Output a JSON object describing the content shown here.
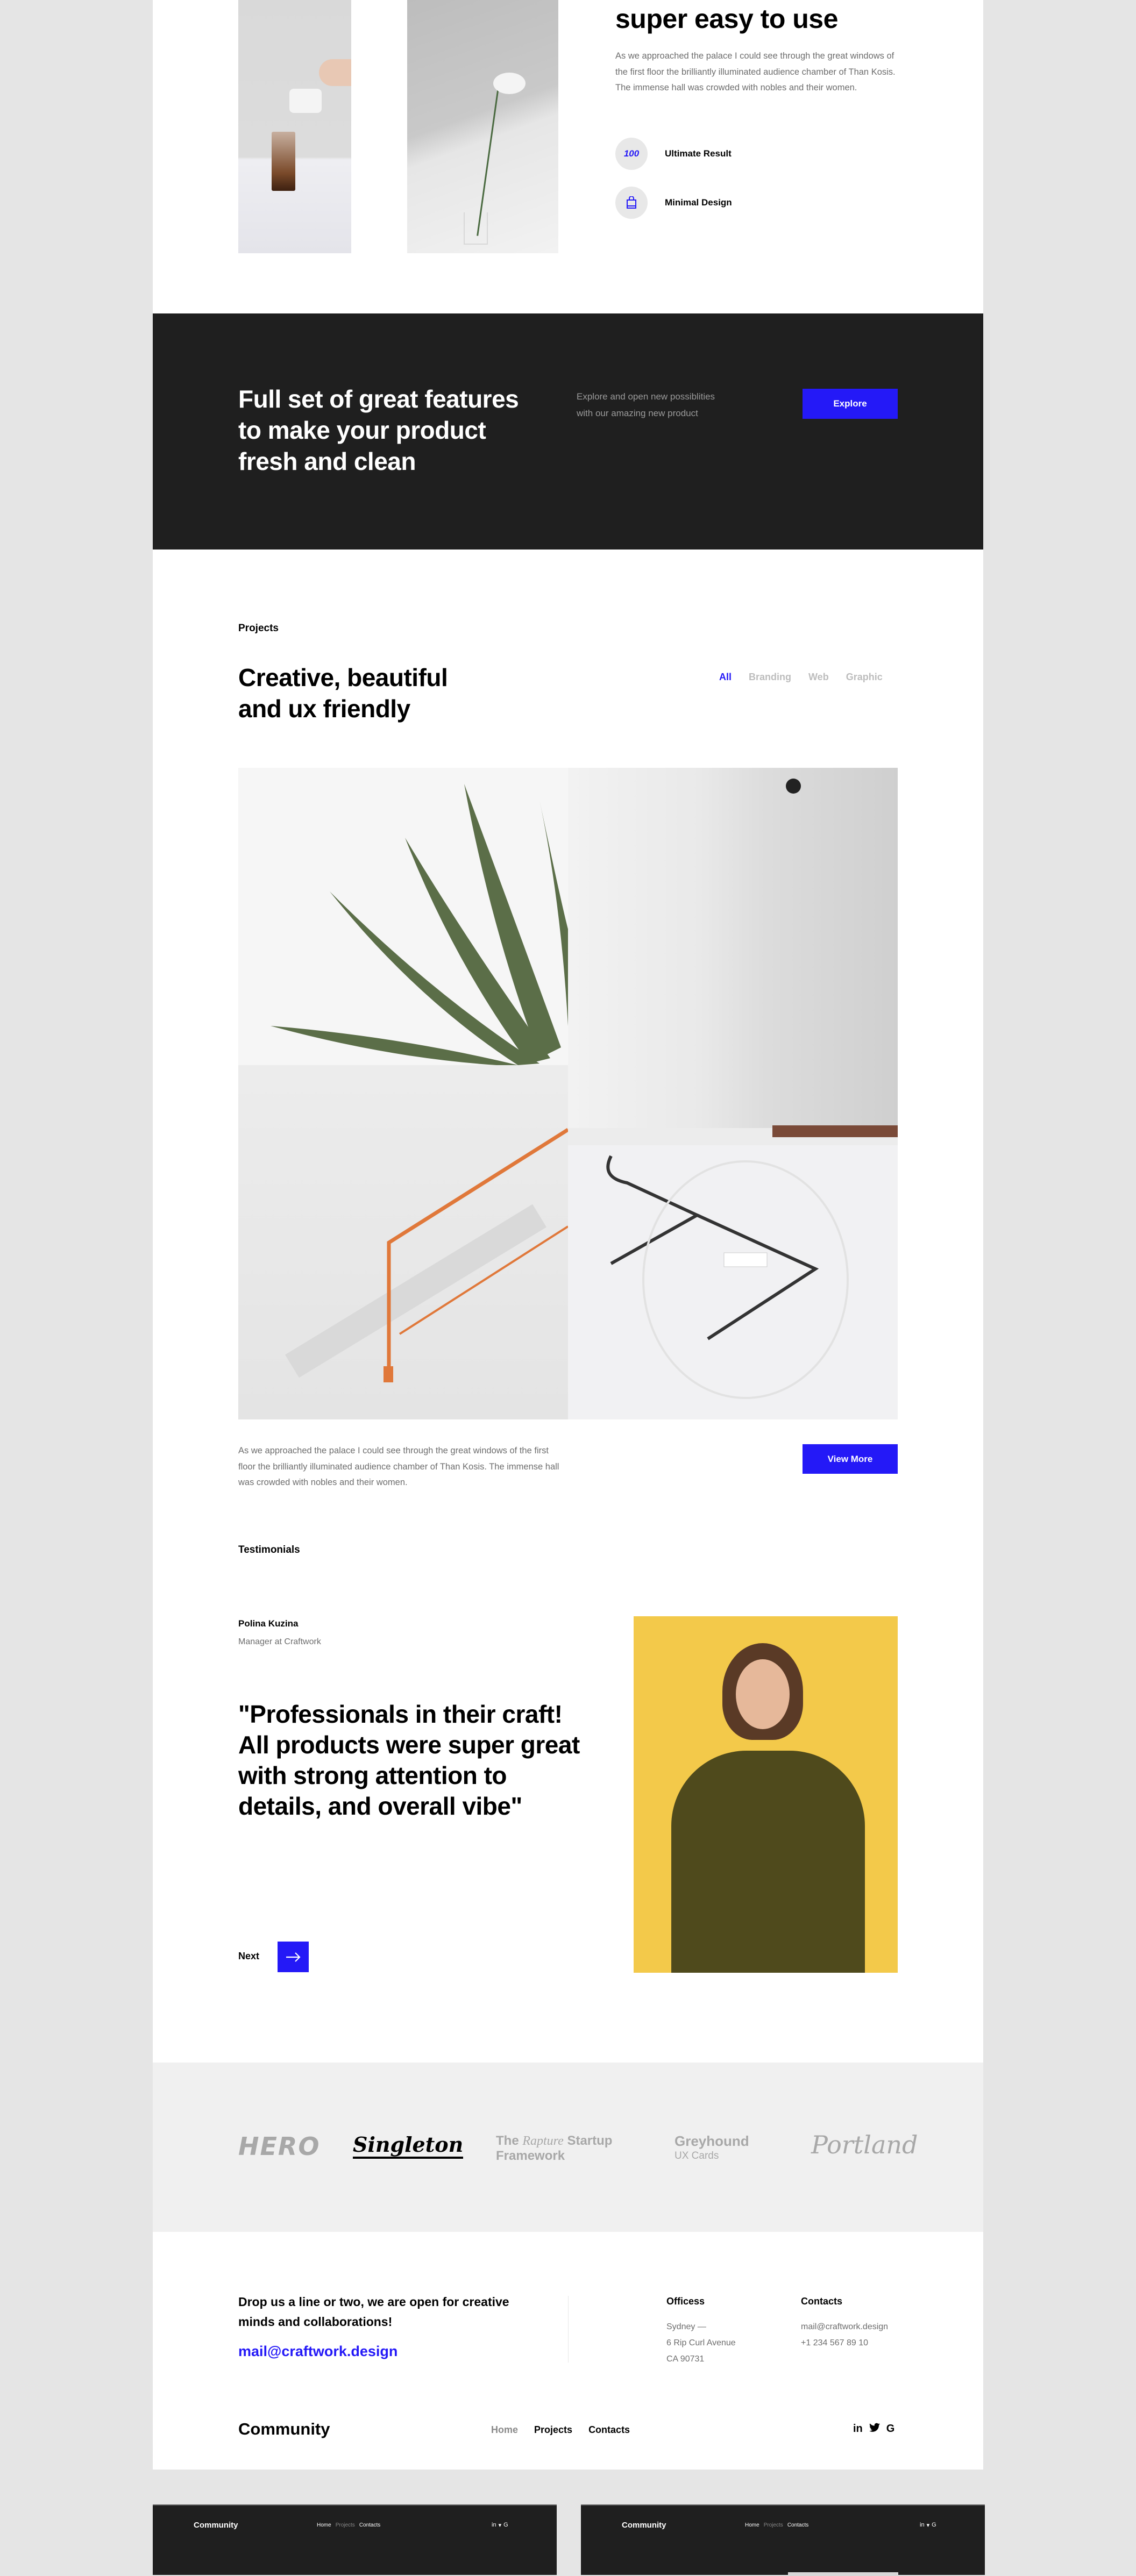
{
  "intro": {
    "heading": "super easy to use",
    "paragraph": "As we approached the palace I could see through the great windows of the first floor the brilliantly illuminated audience chamber of Than Kosis. The immense hall was crowded with nobles and their women.",
    "features": [
      {
        "icon": "hundred-points-icon",
        "glyph": "100",
        "label": "Ultimate Result"
      },
      {
        "icon": "shopping-bag-icon",
        "glyph": "",
        "label": "Minimal Design"
      }
    ]
  },
  "banner": {
    "heading_lines": [
      "Full set of great features",
      "to make your product",
      "fresh and clean"
    ],
    "subtext_lines": [
      "Explore and open new possiblities",
      "with our amazing new product"
    ],
    "button": "Explore"
  },
  "projects": {
    "label": "Projects",
    "heading_lines": [
      "Creative, beautiful",
      "and ux friendly"
    ],
    "filters": [
      "All",
      "Branding",
      "Web",
      "Graphic"
    ],
    "active_filter": "All",
    "description": "As we approached the palace I could see through the great windows of the first floor the brilliantly illuminated audience chamber of Than Kosis. The immense hall was crowded with nobles and their women.",
    "button": "View More"
  },
  "testimonials": {
    "label": "Testimonials",
    "name": "Polina Kuzina",
    "role": "Manager at Craftwork",
    "quote": "\"Professionals in their craft! All products were super great with strong attention to details, and overall vibe\"",
    "next_label": "Next",
    "next_icon": "arrow-right-icon"
  },
  "logos": {
    "hero": "HERO",
    "singleton": "Singleton",
    "rapture": {
      "the": "The",
      "rapture": "Rapture",
      "startup": "Startup",
      "framework": "Framework"
    },
    "greyhound": {
      "name": "Greyhound",
      "sub": "UX Cards"
    },
    "portland": "Portland"
  },
  "contact": {
    "heading": "Drop us a line or two, we are open for creative minds and collaborations!",
    "email": "mail@craftwork.design",
    "offices_title": "Officess",
    "offices_lines": [
      "Sydney —",
      "6 Rip Curl Avenue",
      "CA 90731"
    ],
    "contacts_title": "Contacts",
    "contacts_lines": [
      "mail@craftwork.design",
      "+1 234 567 89 10"
    ]
  },
  "footer": {
    "brand": "Community",
    "nav": [
      "Home",
      "Projects",
      "Contacts"
    ],
    "social": [
      "in",
      "🐦",
      "G"
    ]
  },
  "colors": {
    "accent": "#2419f7",
    "dark": "#1f1f1f",
    "page_bg": "#e5e5e5",
    "logo_band": "#f0f0f0"
  }
}
